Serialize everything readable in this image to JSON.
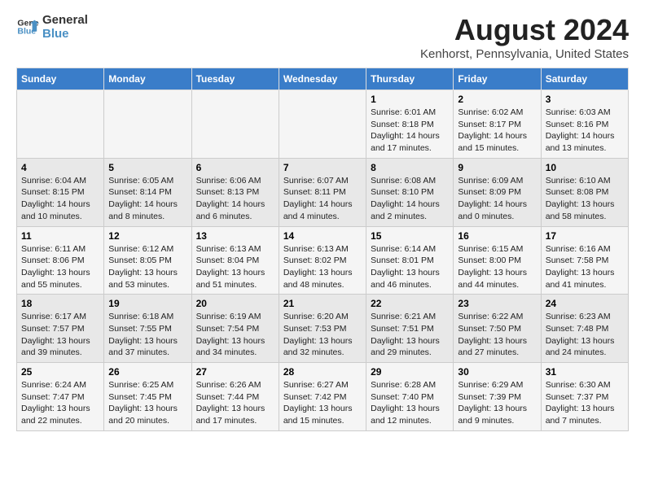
{
  "logo": {
    "line1": "General",
    "line2": "Blue"
  },
  "title": "August 2024",
  "subtitle": "Kenhorst, Pennsylvania, United States",
  "weekdays": [
    "Sunday",
    "Monday",
    "Tuesday",
    "Wednesday",
    "Thursday",
    "Friday",
    "Saturday"
  ],
  "weeks": [
    [
      {
        "day": "",
        "info": ""
      },
      {
        "day": "",
        "info": ""
      },
      {
        "day": "",
        "info": ""
      },
      {
        "day": "",
        "info": ""
      },
      {
        "day": "1",
        "info": "Sunrise: 6:01 AM\nSunset: 8:18 PM\nDaylight: 14 hours\nand 17 minutes."
      },
      {
        "day": "2",
        "info": "Sunrise: 6:02 AM\nSunset: 8:17 PM\nDaylight: 14 hours\nand 15 minutes."
      },
      {
        "day": "3",
        "info": "Sunrise: 6:03 AM\nSunset: 8:16 PM\nDaylight: 14 hours\nand 13 minutes."
      }
    ],
    [
      {
        "day": "4",
        "info": "Sunrise: 6:04 AM\nSunset: 8:15 PM\nDaylight: 14 hours\nand 10 minutes."
      },
      {
        "day": "5",
        "info": "Sunrise: 6:05 AM\nSunset: 8:14 PM\nDaylight: 14 hours\nand 8 minutes."
      },
      {
        "day": "6",
        "info": "Sunrise: 6:06 AM\nSunset: 8:13 PM\nDaylight: 14 hours\nand 6 minutes."
      },
      {
        "day": "7",
        "info": "Sunrise: 6:07 AM\nSunset: 8:11 PM\nDaylight: 14 hours\nand 4 minutes."
      },
      {
        "day": "8",
        "info": "Sunrise: 6:08 AM\nSunset: 8:10 PM\nDaylight: 14 hours\nand 2 minutes."
      },
      {
        "day": "9",
        "info": "Sunrise: 6:09 AM\nSunset: 8:09 PM\nDaylight: 14 hours\nand 0 minutes."
      },
      {
        "day": "10",
        "info": "Sunrise: 6:10 AM\nSunset: 8:08 PM\nDaylight: 13 hours\nand 58 minutes."
      }
    ],
    [
      {
        "day": "11",
        "info": "Sunrise: 6:11 AM\nSunset: 8:06 PM\nDaylight: 13 hours\nand 55 minutes."
      },
      {
        "day": "12",
        "info": "Sunrise: 6:12 AM\nSunset: 8:05 PM\nDaylight: 13 hours\nand 53 minutes."
      },
      {
        "day": "13",
        "info": "Sunrise: 6:13 AM\nSunset: 8:04 PM\nDaylight: 13 hours\nand 51 minutes."
      },
      {
        "day": "14",
        "info": "Sunrise: 6:13 AM\nSunset: 8:02 PM\nDaylight: 13 hours\nand 48 minutes."
      },
      {
        "day": "15",
        "info": "Sunrise: 6:14 AM\nSunset: 8:01 PM\nDaylight: 13 hours\nand 46 minutes."
      },
      {
        "day": "16",
        "info": "Sunrise: 6:15 AM\nSunset: 8:00 PM\nDaylight: 13 hours\nand 44 minutes."
      },
      {
        "day": "17",
        "info": "Sunrise: 6:16 AM\nSunset: 7:58 PM\nDaylight: 13 hours\nand 41 minutes."
      }
    ],
    [
      {
        "day": "18",
        "info": "Sunrise: 6:17 AM\nSunset: 7:57 PM\nDaylight: 13 hours\nand 39 minutes."
      },
      {
        "day": "19",
        "info": "Sunrise: 6:18 AM\nSunset: 7:55 PM\nDaylight: 13 hours\nand 37 minutes."
      },
      {
        "day": "20",
        "info": "Sunrise: 6:19 AM\nSunset: 7:54 PM\nDaylight: 13 hours\nand 34 minutes."
      },
      {
        "day": "21",
        "info": "Sunrise: 6:20 AM\nSunset: 7:53 PM\nDaylight: 13 hours\nand 32 minutes."
      },
      {
        "day": "22",
        "info": "Sunrise: 6:21 AM\nSunset: 7:51 PM\nDaylight: 13 hours\nand 29 minutes."
      },
      {
        "day": "23",
        "info": "Sunrise: 6:22 AM\nSunset: 7:50 PM\nDaylight: 13 hours\nand 27 minutes."
      },
      {
        "day": "24",
        "info": "Sunrise: 6:23 AM\nSunset: 7:48 PM\nDaylight: 13 hours\nand 24 minutes."
      }
    ],
    [
      {
        "day": "25",
        "info": "Sunrise: 6:24 AM\nSunset: 7:47 PM\nDaylight: 13 hours\nand 22 minutes."
      },
      {
        "day": "26",
        "info": "Sunrise: 6:25 AM\nSunset: 7:45 PM\nDaylight: 13 hours\nand 20 minutes."
      },
      {
        "day": "27",
        "info": "Sunrise: 6:26 AM\nSunset: 7:44 PM\nDaylight: 13 hours\nand 17 minutes."
      },
      {
        "day": "28",
        "info": "Sunrise: 6:27 AM\nSunset: 7:42 PM\nDaylight: 13 hours\nand 15 minutes."
      },
      {
        "day": "29",
        "info": "Sunrise: 6:28 AM\nSunset: 7:40 PM\nDaylight: 13 hours\nand 12 minutes."
      },
      {
        "day": "30",
        "info": "Sunrise: 6:29 AM\nSunset: 7:39 PM\nDaylight: 13 hours\nand 9 minutes."
      },
      {
        "day": "31",
        "info": "Sunrise: 6:30 AM\nSunset: 7:37 PM\nDaylight: 13 hours\nand 7 minutes."
      }
    ]
  ]
}
